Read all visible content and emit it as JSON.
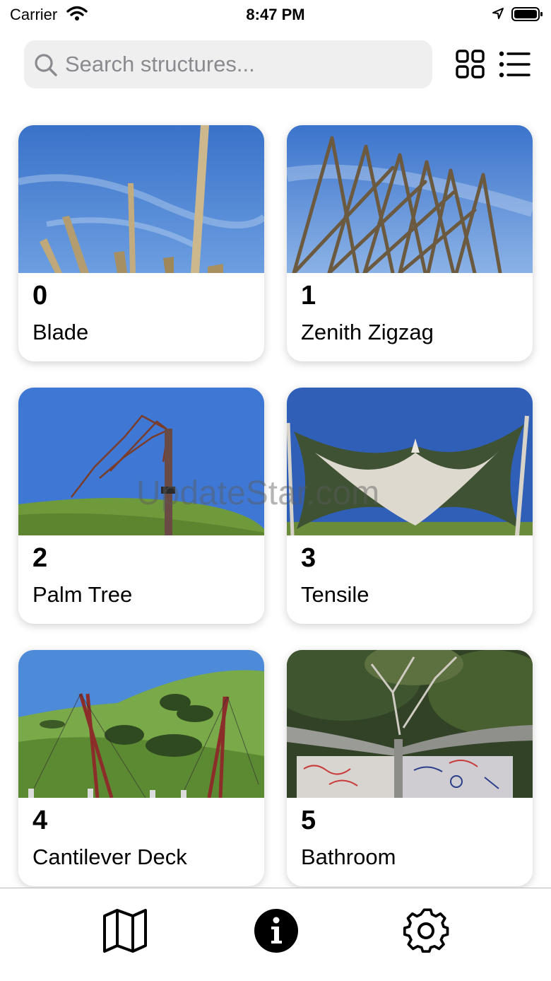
{
  "status_bar": {
    "carrier": "Carrier",
    "time": "8:47 PM",
    "icons": [
      "wifi-icon",
      "location-arrow-icon",
      "battery-icon"
    ]
  },
  "search": {
    "placeholder": "Search structures...",
    "value": ""
  },
  "view_toggles": [
    "grid-view-icon",
    "list-view-icon"
  ],
  "structures": [
    {
      "number": "0",
      "name": "Blade"
    },
    {
      "number": "1",
      "name": "Zenith Zigzag"
    },
    {
      "number": "2",
      "name": "Palm Tree"
    },
    {
      "number": "3",
      "name": "Tensile"
    },
    {
      "number": "4",
      "name": "Cantilever Deck"
    },
    {
      "number": "5",
      "name": "Bathroom"
    }
  ],
  "watermark": "UpdateStar.com",
  "tab_bar": {
    "tabs": [
      "map-icon",
      "info-icon",
      "settings-gear-icon"
    ],
    "selected": "info-icon"
  },
  "colors": {
    "sky": "#3f78d4",
    "grass": "#6f9a3c",
    "search_bg": "#efeff0",
    "placeholder": "#8a8a8f"
  }
}
